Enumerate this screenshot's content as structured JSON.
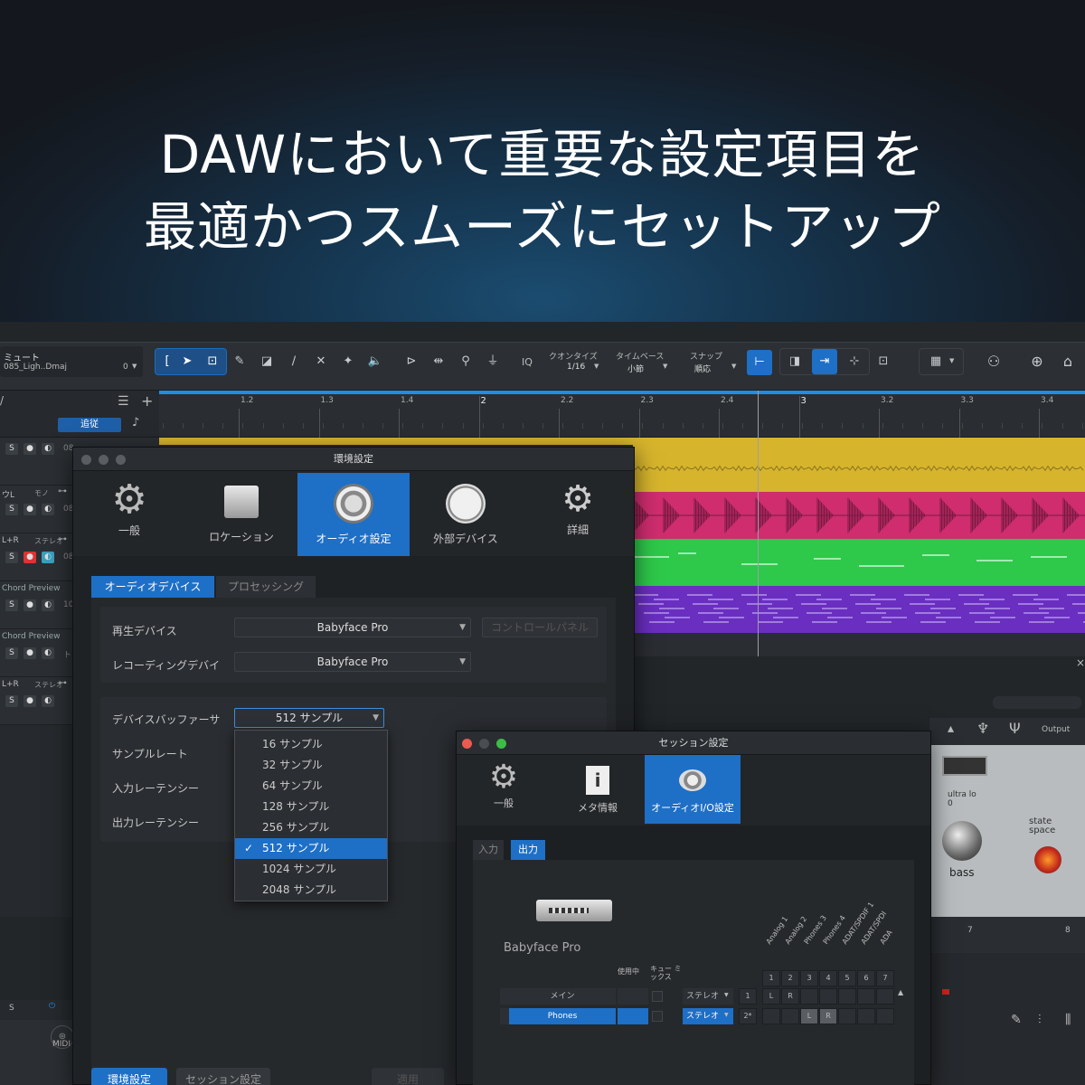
{
  "headline": {
    "line1": "DAWにおいて重要な設定項目を",
    "line2": "最適かつスムーズにセットアップ"
  },
  "toolbar": {
    "track_name": "ミュート",
    "song_name": "085_Ligh..Dmaj",
    "counter": "0",
    "quantize_label": "クオンタイズ",
    "quantize_value": "1/16",
    "timebase_label": "タイムベース",
    "timebase_value": "小節",
    "snap_label": "スナップ",
    "snap_value": "順応",
    "iq_label": "IQ"
  },
  "track_list": {
    "follow_label": "追従",
    "tracks": [
      {
        "label": "",
        "num": "08"
      },
      {
        "label": "ウL",
        "sub": "モノ",
        "num": "08"
      },
      {
        "label": "L+R",
        "sub": "ステレオ",
        "num": "08"
      },
      {
        "label": "Chord Preview",
        "num": "10"
      },
      {
        "label": "Chord Preview",
        "num": "ト"
      },
      {
        "label": "L+R",
        "sub": "ステレオ",
        "num": ""
      }
    ],
    "solo": "S",
    "midi_label": "MIDI"
  },
  "ruler": {
    "marks": [
      "1.2",
      "1.3",
      "1.4",
      "2",
      "2.2",
      "2.3",
      "2.4",
      "3",
      "3.2",
      "3.3",
      "3.4"
    ]
  },
  "clip_colors": {
    "yellow": "#d6b42c",
    "pink": "#cf2d6e",
    "green": "#2ec84a",
    "purple": "#6a2ec0"
  },
  "mixer": {
    "output_label": "Output",
    "plugin_label_1": "ultra lo",
    "plugin_value_1": "0",
    "plugin_label_2": "state space",
    "knob_label": "bass",
    "bar_nums": [
      "7",
      "8"
    ]
  },
  "prefs": {
    "title": "環境設定",
    "categories": [
      "一般",
      "ロケーション",
      "オーディオ設定",
      "外部デバイス",
      "詳細"
    ],
    "active_category": "オーディオ設定",
    "tabs": [
      "オーディオデバイス",
      "プロセッシング"
    ],
    "playback_label": "再生デバイス",
    "playback_value": "Babyface Pro",
    "control_panel_label": "コントロールパネル",
    "recording_label": "レコーディングデバイ",
    "recording_value": "Babyface Pro",
    "buffer_label": "デバイスバッファーサ",
    "buffer_value": "512 サンプル",
    "samplerate_label": "サンプルレート",
    "input_latency_label": "入力レーテンシー",
    "output_latency_label": "出力レーテンシー",
    "buffer_options": [
      "16 サンプル",
      "32 サンプル",
      "64 サンプル",
      "128 サンプル",
      "256 サンプル",
      "512 サンプル",
      "1024 サンプル",
      "2048 サンプル"
    ],
    "checkmark": "✓",
    "footer_buttons": [
      "環境設定",
      "セッション設定",
      "適用"
    ]
  },
  "session": {
    "title": "セッション設定",
    "categories": [
      "一般",
      "メタ情報",
      "オーディオI/O設定"
    ],
    "active_category": "オーディオI/O設定",
    "tabs": [
      "入力",
      "出力"
    ],
    "device_name": "Babyface Pro",
    "col_in_use": "使用中",
    "col_cue_mix": "キュー ミックス",
    "channels": [
      "Analog 1",
      "Analog 2",
      "Phones 3",
      "Phones 4",
      "ADAT/SPDIF 1",
      "ADAT/SPDI",
      "ADA"
    ],
    "channel_nums": [
      "1",
      "2",
      "3",
      "4",
      "5",
      "6",
      "7"
    ],
    "rows": [
      {
        "name": "メイン",
        "format": "ステレオ",
        "idx": "1",
        "l": "L",
        "r": "R"
      },
      {
        "name": "Phones",
        "format": "ステレオ",
        "idx": "2*",
        "l": "L",
        "r": "R"
      }
    ]
  }
}
